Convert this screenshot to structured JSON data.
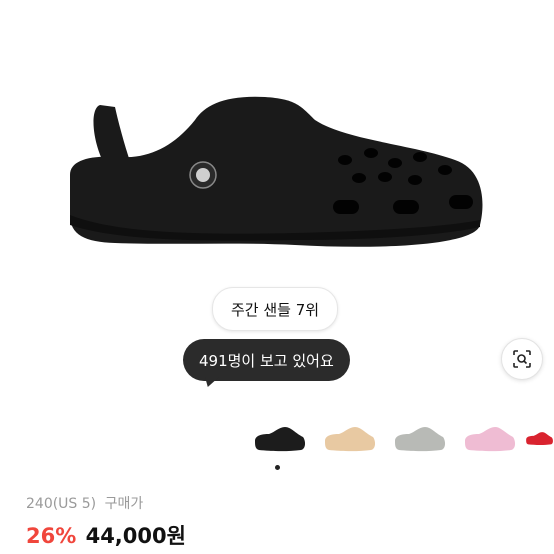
{
  "product": {
    "image_alt": "black clog",
    "ranking_badge": "주간 샌들 7위",
    "viewers_text": "491명이 보고 있어요"
  },
  "colors": {
    "main": "#1a1a1a",
    "discount": "#f0463c",
    "thumb_variants": [
      "#1c1c1c",
      "#e8c9a2",
      "#b8bab6",
      "#efbcd3",
      "#d9232f"
    ]
  },
  "gallery": {
    "thumbnails": [
      {
        "name": "black"
      },
      {
        "name": "beige"
      },
      {
        "name": "gray"
      },
      {
        "name": "pink"
      },
      {
        "name": "red"
      }
    ],
    "page_indicator_count": 1
  },
  "option": {
    "size": "240(US 5)",
    "type": "구매가"
  },
  "pricing": {
    "discount": "26%",
    "price": "44,000원"
  },
  "icons": {
    "lens": "image-search-icon"
  }
}
